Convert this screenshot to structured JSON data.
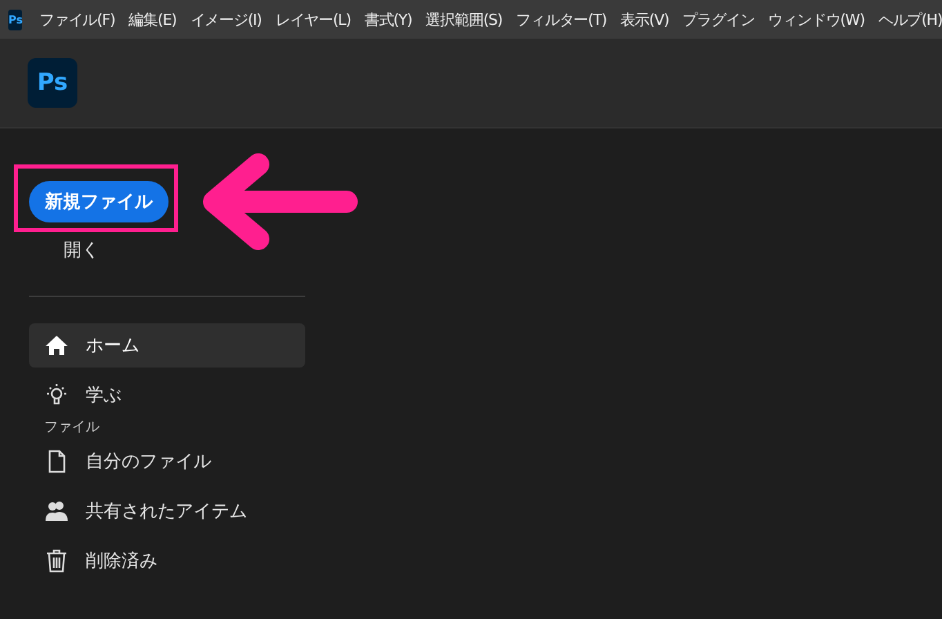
{
  "menu_bar": {
    "logo": "Ps",
    "items": [
      "ファイル(F)",
      "編集(E)",
      "イメージ(I)",
      "レイヤー(L)",
      "書式(Y)",
      "選択範囲(S)",
      "フィルター(T)",
      "表示(V)",
      "プラグイン",
      "ウィンドウ(W)",
      "ヘルプ(H)"
    ]
  },
  "header": {
    "logo": "Ps"
  },
  "sidebar": {
    "new_file_button": "新規ファイル",
    "open_link": "開く",
    "nav": [
      {
        "label": "ホーム",
        "kind": "home",
        "selected": true
      },
      {
        "label": "学ぶ",
        "kind": "learn",
        "selected": false
      }
    ],
    "section_label": "ファイル",
    "files": [
      {
        "label": "自分のファイル",
        "kind": "file",
        "selected": false
      },
      {
        "label": "共有されたアイテム",
        "kind": "shared",
        "selected": false
      },
      {
        "label": "削除済み",
        "kind": "trash",
        "selected": false
      }
    ]
  }
}
